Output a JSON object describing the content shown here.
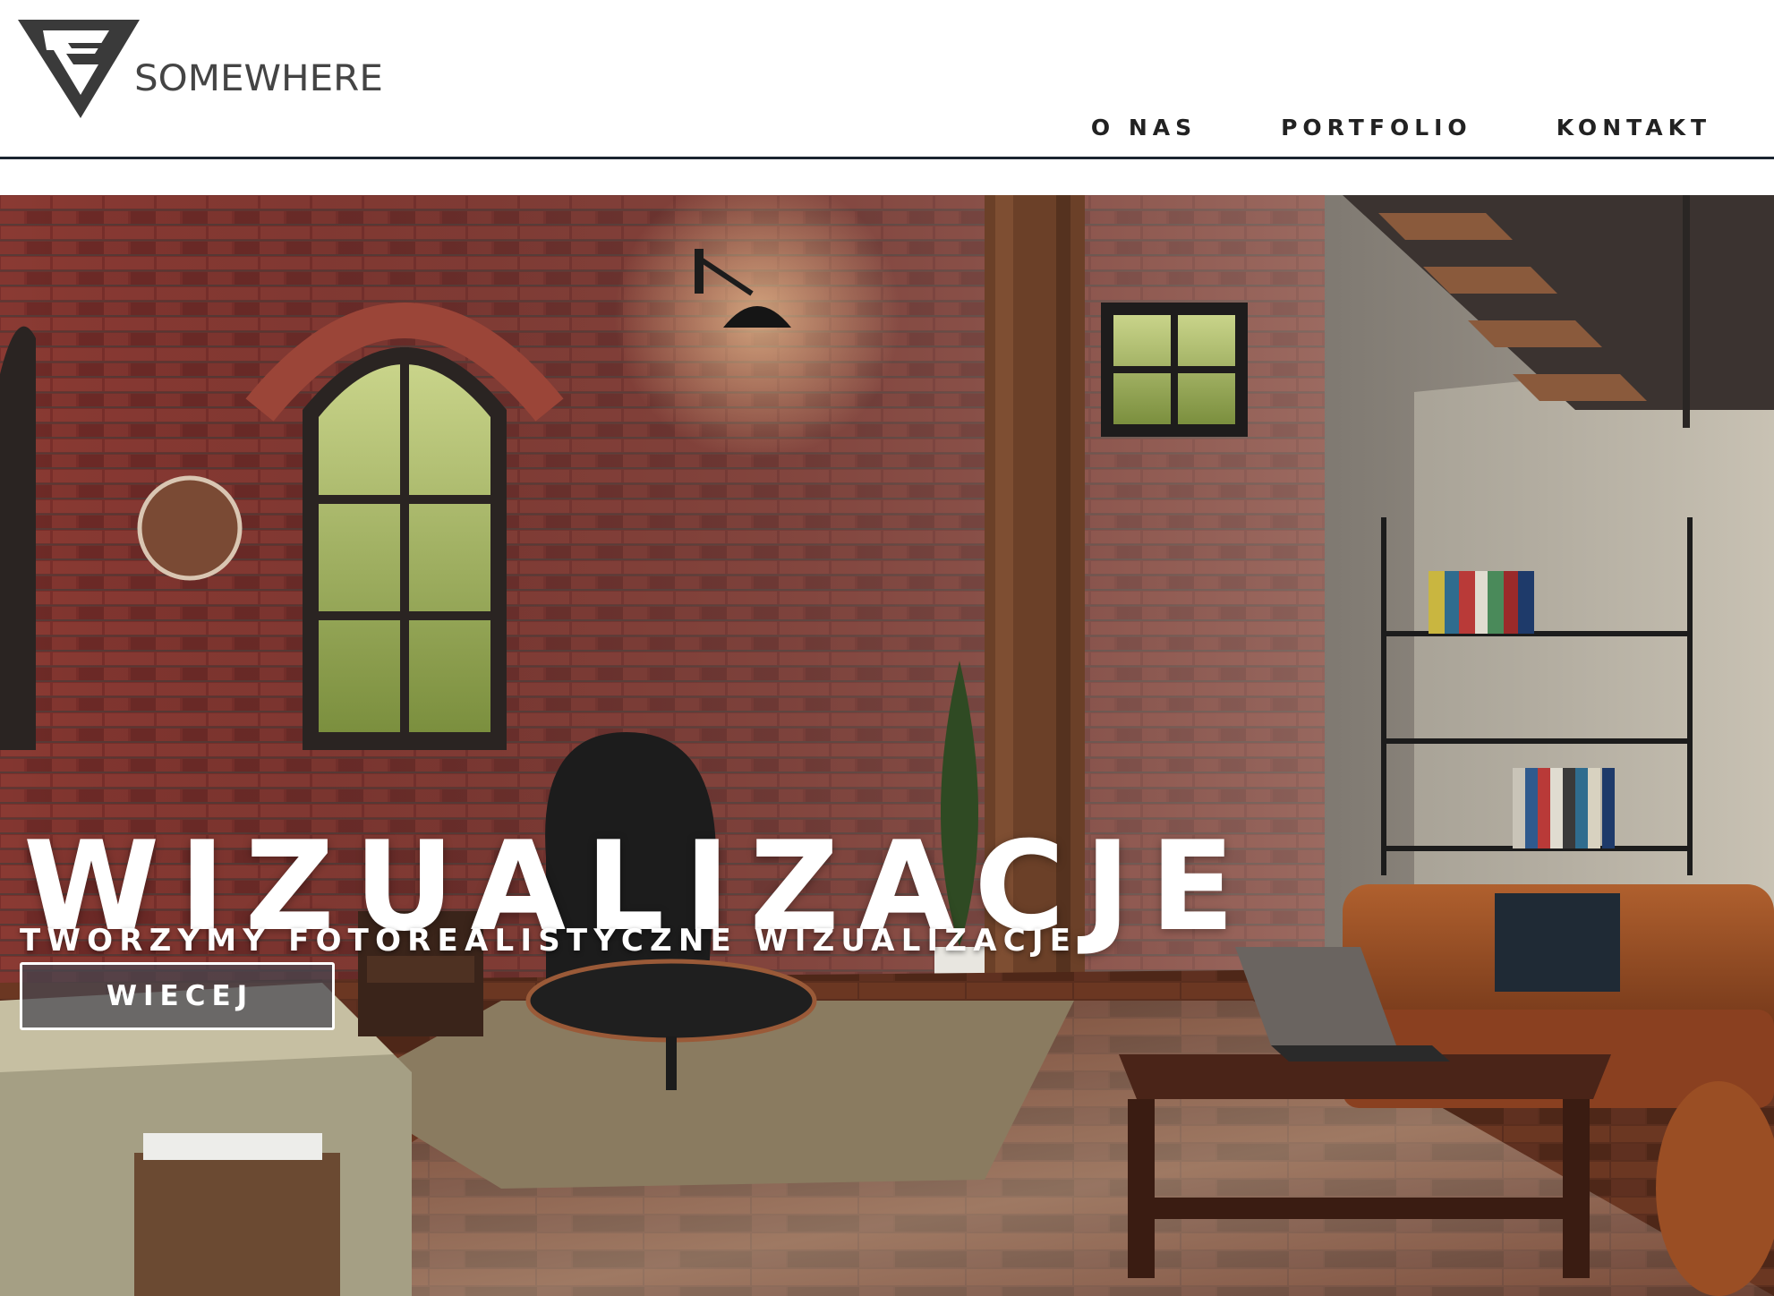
{
  "header": {
    "logo_text": "SOMEWHERE",
    "logo_icon": "somewhere-triangle-logo",
    "nav": [
      {
        "label": "O NAS"
      },
      {
        "label": "PORTFOLIO"
      },
      {
        "label": "KONTAKT"
      }
    ]
  },
  "hero": {
    "background_image": "loft-interior-visualization",
    "title": "WIZUALIZACJE",
    "subtitle": "TWORZYMY FOTOREALISTYCZNE WIZUALIZACJE",
    "button_label": "WIECEJ"
  },
  "colors": {
    "header_background": "#ffffff",
    "header_border": "#1b2430",
    "nav_text": "#222222",
    "logo": "#3a3a3a",
    "hero_text": "#ffffff",
    "button_fill": "#464650"
  }
}
